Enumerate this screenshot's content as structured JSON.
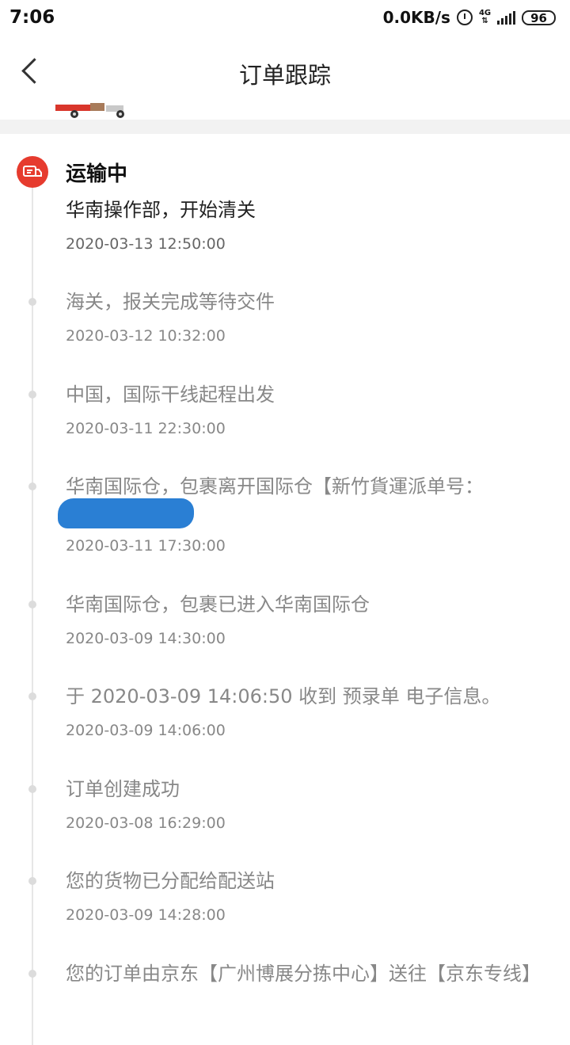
{
  "status_bar": {
    "time": "7:06",
    "speed": "0.0KB/s",
    "network": "4G",
    "battery": "96"
  },
  "header": {
    "title": "订单跟踪"
  },
  "shipment": {
    "status_title": "运输中",
    "status_color": "#e63b2e"
  },
  "events": [
    {
      "text": "华南操作部，开始清关",
      "time": "2020-03-13 12:50:00"
    },
    {
      "text": "海关，报关完成等待交件",
      "time": "2020-03-12 10:32:00"
    },
    {
      "text": "中国，国际干线起程出发",
      "time": "2020-03-11 22:30:00"
    },
    {
      "text": "华南国际仓，包裹离开国际仓【新竹貨運派单号：",
      "time": "2020-03-11 17:30:00"
    },
    {
      "text": "华南国际仓，包裹已进入华南国际仓",
      "time": "2020-03-09 14:30:00"
    },
    {
      "text": "于 2020-03-09 14:06:50 收到 预录单 电子信息。",
      "time": "2020-03-09 14:06:00"
    },
    {
      "text": "订单创建成功",
      "time": "2020-03-08 16:29:00"
    },
    {
      "text": "您的货物已分配给配送站",
      "time": "2020-03-09 14:28:00"
    },
    {
      "text": "您的订单由京东【广州博展分拣中心】送往【京东专线】",
      "time": ""
    }
  ]
}
